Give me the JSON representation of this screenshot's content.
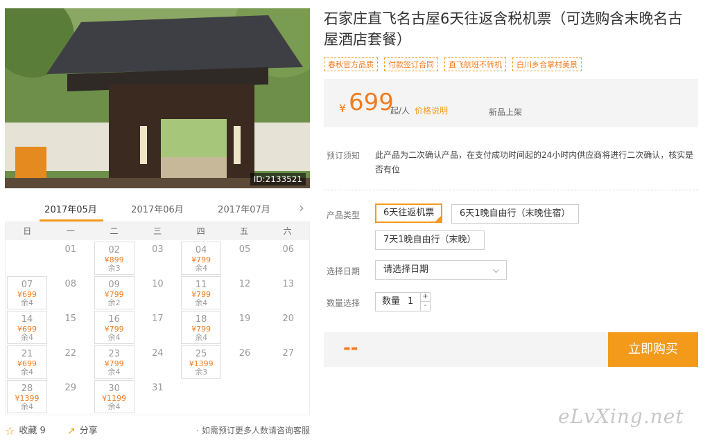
{
  "photo": {
    "id_label": "ID:2133521"
  },
  "calendar": {
    "months": [
      "2017年05月",
      "2017年06月",
      "2017年07月"
    ],
    "next_icon": "chevron-right-icon",
    "weekdays": [
      "日",
      "一",
      "二",
      "三",
      "四",
      "五",
      "六"
    ],
    "days": [
      {
        "day": "01",
        "col": 1,
        "row": 0
      },
      {
        "day": "02",
        "col": 2,
        "row": 0,
        "price": "¥899",
        "remain": "余3"
      },
      {
        "day": "03",
        "col": 3,
        "row": 0
      },
      {
        "day": "04",
        "col": 4,
        "row": 0,
        "price": "¥799",
        "remain": "余4"
      },
      {
        "day": "05",
        "col": 5,
        "row": 0
      },
      {
        "day": "06",
        "col": 6,
        "row": 0
      },
      {
        "day": "07",
        "col": 0,
        "row": 1,
        "price": "¥699",
        "remain": "余4"
      },
      {
        "day": "08",
        "col": 1,
        "row": 1
      },
      {
        "day": "09",
        "col": 2,
        "row": 1,
        "price": "¥799",
        "remain": "余2"
      },
      {
        "day": "10",
        "col": 3,
        "row": 1
      },
      {
        "day": "11",
        "col": 4,
        "row": 1,
        "price": "¥799",
        "remain": "余4"
      },
      {
        "day": "12",
        "col": 5,
        "row": 1
      },
      {
        "day": "13",
        "col": 6,
        "row": 1
      },
      {
        "day": "14",
        "col": 0,
        "row": 2,
        "price": "¥699",
        "remain": "余4"
      },
      {
        "day": "15",
        "col": 1,
        "row": 2
      },
      {
        "day": "16",
        "col": 2,
        "row": 2,
        "price": "¥799",
        "remain": "余4"
      },
      {
        "day": "17",
        "col": 3,
        "row": 2
      },
      {
        "day": "18",
        "col": 4,
        "row": 2,
        "price": "¥799",
        "remain": "余4"
      },
      {
        "day": "19",
        "col": 5,
        "row": 2
      },
      {
        "day": "20",
        "col": 6,
        "row": 2
      },
      {
        "day": "21",
        "col": 0,
        "row": 3,
        "price": "¥699",
        "remain": "余4"
      },
      {
        "day": "22",
        "col": 1,
        "row": 3
      },
      {
        "day": "23",
        "col": 2,
        "row": 3,
        "price": "¥799",
        "remain": "余4"
      },
      {
        "day": "24",
        "col": 3,
        "row": 3
      },
      {
        "day": "25",
        "col": 4,
        "row": 3,
        "price": "¥1399",
        "remain": "余3"
      },
      {
        "day": "26",
        "col": 5,
        "row": 3
      },
      {
        "day": "27",
        "col": 6,
        "row": 3
      },
      {
        "day": "28",
        "col": 0,
        "row": 4,
        "price": "¥1399",
        "remain": "余4"
      },
      {
        "day": "29",
        "col": 1,
        "row": 4
      },
      {
        "day": "30",
        "col": 2,
        "row": 4,
        "price": "¥1199",
        "remain": "余4"
      },
      {
        "day": "31",
        "col": 3,
        "row": 4
      }
    ]
  },
  "bottom": {
    "fav_label": "收藏 9",
    "share_label": "分享",
    "note": "· 如需预订更多人数请咨询客服"
  },
  "product": {
    "title": "石家庄直飞名古屋6天往返含税机票（可选购含末晚名古屋酒店套餐）",
    "tags": [
      "春秋官方品质",
      "付款签订合同",
      "直飞航班不转机",
      "白川乡合掌村美景"
    ],
    "price": {
      "currency": "¥",
      "amount": "699",
      "unit": "起/人",
      "note": "价格说明",
      "new_tag": "新品上架"
    },
    "notice_label": "预订须知",
    "notice_text": "此产品为二次确认产品，在支付成功时间起的24小时内供应商将进行二次确认，核实是否有位",
    "type_label": "产品类型",
    "types": [
      "6天往返机票",
      "6天1晚自由行（末晚住宿）",
      "7天1晚自由行（末晚）"
    ],
    "date_label": "选择日期",
    "date_placeholder": "请选择日期",
    "qty_label": "数量选择",
    "qty_prefix": "数量",
    "qty_value": "1",
    "qty_plus": "+",
    "qty_minus": "-",
    "total": "--",
    "buy_label": "立即购买"
  },
  "watermark": "eLvXing.net",
  "colors": {
    "accent": "#f39a1b",
    "price": "#f37b1d"
  }
}
